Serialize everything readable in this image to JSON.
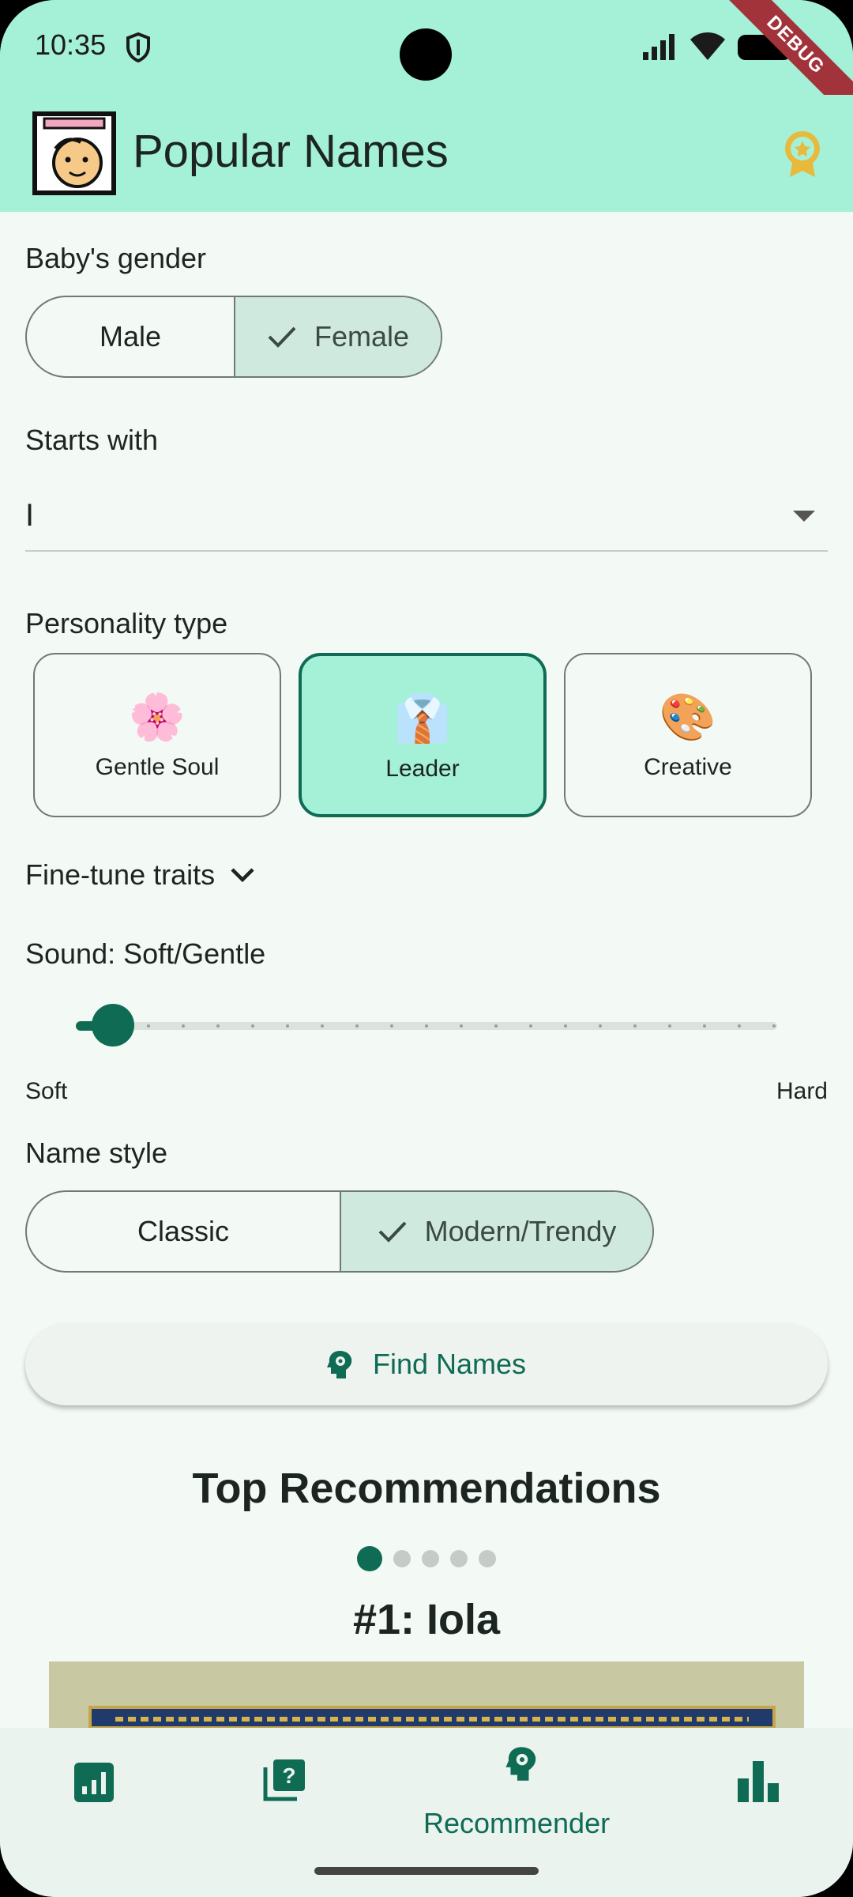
{
  "status_bar": {
    "time": "10:35"
  },
  "debug_ribbon": "DEBUG",
  "app_bar": {
    "title": "Popular Names",
    "logo_icon": "baby-face-icon",
    "action_icon": "award-icon"
  },
  "gender": {
    "label": "Baby's gender",
    "options": [
      "Male",
      "Female"
    ],
    "selected": "Female"
  },
  "starts_with": {
    "label": "Starts with",
    "value": "I"
  },
  "personality": {
    "label": "Personality type",
    "options": [
      {
        "emoji": "🌸",
        "label": "Gentle Soul"
      },
      {
        "emoji": "👔",
        "label": "Leader"
      },
      {
        "emoji": "🎨",
        "label": "Creative"
      }
    ],
    "selected": "Leader"
  },
  "finetune": {
    "label": "Fine-tune traits"
  },
  "sound": {
    "label": "Sound: Soft/Gentle",
    "min_label": "Soft",
    "max_label": "Hard",
    "value_fraction": 0.04
  },
  "name_style": {
    "label": "Name style",
    "options": [
      "Classic",
      "Modern/Trendy"
    ],
    "selected": "Modern/Trendy"
  },
  "find_button": {
    "label": "Find Names"
  },
  "recommendations": {
    "title": "Top Recommendations",
    "page_count": 5,
    "current_page": 1,
    "current_name": "#1: Iola"
  },
  "bottom_nav": {
    "items": [
      "stats-icon",
      "quiz-icon",
      "recommender-icon",
      "bar-chart-icon"
    ],
    "active_label": "Recommender"
  },
  "colors": {
    "primary": "#0f6b54",
    "app_bar": "#a4f1d8",
    "background": "#f3f9f5",
    "selected_segment": "#cfe9de"
  }
}
